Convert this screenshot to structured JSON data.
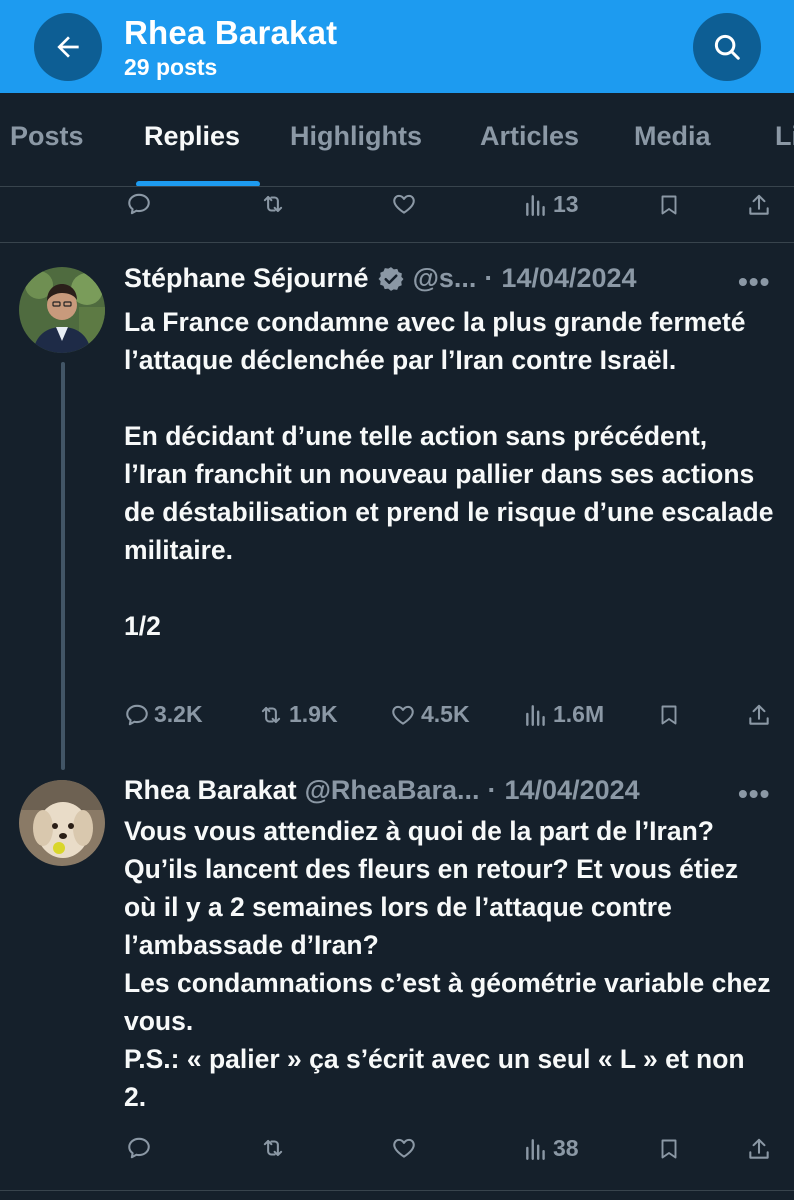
{
  "header": {
    "title": "Rhea Barakat",
    "subtitle": "29 posts"
  },
  "tabs": [
    {
      "label": "Posts",
      "active": false
    },
    {
      "label": "Replies",
      "active": true
    },
    {
      "label": "Highlights",
      "active": false
    },
    {
      "label": "Articles",
      "active": false
    },
    {
      "label": "Media",
      "active": false
    },
    {
      "label": "Li",
      "active": false
    }
  ],
  "prev_tweet": {
    "views": "13"
  },
  "tweet1": {
    "name": "Stéphane Séjourné",
    "handle": "@s...",
    "separator": "·",
    "date": "14/04/2024",
    "more": "•••",
    "text": "La France condamne avec la plus grande fermeté l’attaque déclenchée par l’Iran contre Israël.\n\nEn décidant d’une telle action sans précédent, l’Iran franchit un nouveau pallier dans ses actions de déstabilisation et prend le risque d’une escalade militaire.\n\n1/2",
    "replies": "3.2K",
    "retweets": "1.9K",
    "likes": "4.5K",
    "views": "1.6M"
  },
  "tweet2": {
    "name": "Rhea Barakat",
    "handle": "@RheaBara...",
    "separator": "·",
    "date": "14/04/2024",
    "more": "•••",
    "text": "Vous vous attendiez à quoi de la part de l’Iran? Qu’ils lancent des fleurs en retour? Et vous étiez où il y a 2 semaines lors de l’attaque contre l’ambassade d’Iran?\nLes condamnations c’est à géométrie variable chez vous.\nP.S.: « palier » ça s’écrit avec un seul « L » et non 2.",
    "views": "38"
  },
  "colors": {
    "header_bg": "#1d9bf0",
    "page_bg": "#15202b",
    "muted": "#8b98a5",
    "accent": "#1d9bf0"
  },
  "icons": {
    "back": "arrow-left-icon",
    "search": "search-icon",
    "verified": "verified-badge-icon",
    "reply": "reply-icon",
    "retweet": "retweet-icon",
    "like": "heart-icon",
    "views": "views-icon",
    "bookmark": "bookmark-icon",
    "share": "share-icon"
  }
}
